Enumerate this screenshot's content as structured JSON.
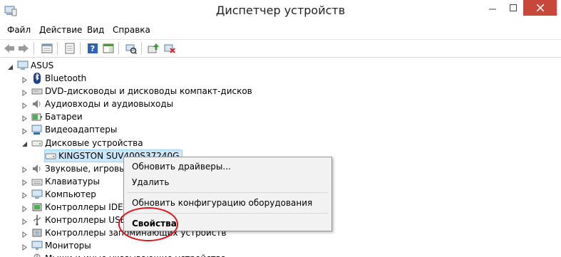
{
  "window": {
    "title": "Диспетчер устройств",
    "minimize_icon": "minimize-icon",
    "maximize_icon": "maximize-icon",
    "close_icon": "close-icon"
  },
  "menu": [
    "Файл",
    "Действие",
    "Вид",
    "Справка"
  ],
  "tree": {
    "root": "ASUS",
    "items": [
      {
        "label": "Bluetooth",
        "icon": "bluetooth-icon"
      },
      {
        "label": "DVD-дисководы и дисководы компакт-дисков",
        "icon": "dvd-drive-icon"
      },
      {
        "label": "Аудиовходы и аудиовыходы",
        "icon": "speaker-icon"
      },
      {
        "label": "Батареи",
        "icon": "battery-icon"
      },
      {
        "label": "Видеоадаптеры",
        "icon": "display-adapter-icon"
      },
      {
        "label": "Дисковые устройства",
        "icon": "disk-drive-icon",
        "expanded": true
      },
      {
        "label": "KINGSTON SUV400S37240G",
        "icon": "disk-drive-icon",
        "child": true,
        "selected": true
      },
      {
        "label": "Звуковые, игровые и видеоустройства",
        "icon": "speaker-icon"
      },
      {
        "label": "Клавиатуры",
        "icon": "keyboard-icon"
      },
      {
        "label": "Компьютер",
        "icon": "computer-icon"
      },
      {
        "label": "Контроллеры IDE ATA/ATAPI",
        "icon": "controller-icon"
      },
      {
        "label": "Контроллеры USB",
        "icon": "usb-icon"
      },
      {
        "label": "Контроллеры запоминающих устройств",
        "icon": "storage-controller-icon"
      },
      {
        "label": "Мониторы",
        "icon": "monitor-icon"
      },
      {
        "label": "Мыши и иные указывающие устройства",
        "icon": "mouse-icon"
      }
    ]
  },
  "context_menu": {
    "update_drivers": "Обновить драйверы...",
    "delete": "Удалить",
    "scan_hardware": "Обновить конфигурацию оборудования",
    "properties": "Свойства"
  }
}
